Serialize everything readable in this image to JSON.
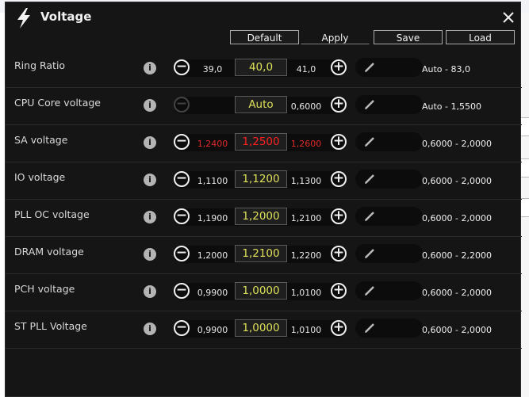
{
  "window": {
    "title": "Voltage",
    "title_icon": "lightning-icon",
    "close_icon": "close-icon"
  },
  "toolbar": {
    "default_label": "Default",
    "apply_label": "Apply",
    "save_label": "Save",
    "load_label": "Load"
  },
  "rows": [
    {
      "label": "Ring Ratio",
      "low": "39,0",
      "value": "40,0",
      "high": "41,0",
      "range": "Auto - 83,0",
      "red": false,
      "minus_enabled": true
    },
    {
      "label": "CPU Core voltage",
      "low": "",
      "value": "Auto",
      "high": "0,6000",
      "range": "Auto - 1,5500",
      "red": false,
      "minus_enabled": false
    },
    {
      "label": "SA voltage",
      "low": "1,2400",
      "value": "1,2500",
      "high": "1,2600",
      "range": "0,6000 - 2,0000",
      "red": true,
      "minus_enabled": true
    },
    {
      "label": "IO voltage",
      "low": "1,1100",
      "value": "1,1200",
      "high": "1,1300",
      "range": "0,6000 - 2,0000",
      "red": false,
      "minus_enabled": true
    },
    {
      "label": "PLL OC voltage",
      "low": "1,1900",
      "value": "1,2000",
      "high": "1,2100",
      "range": "0,6000 - 2,0000",
      "red": false,
      "minus_enabled": true
    },
    {
      "label": "DRAM voltage",
      "low": "1,2000",
      "value": "1,2100",
      "high": "1,2200",
      "range": "0,6000 - 2,2000",
      "red": false,
      "minus_enabled": true
    },
    {
      "label": "PCH voltage",
      "low": "0,9900",
      "value": "1,0000",
      "high": "1,0100",
      "range": "0,6000 - 2,0000",
      "red": false,
      "minus_enabled": true
    },
    {
      "label": "ST PLL Voltage",
      "low": "0,9900",
      "value": "1,0000",
      "high": "1,0100",
      "range": "0,6000 - 2,0000",
      "red": false,
      "minus_enabled": true
    }
  ],
  "icons": {
    "info": "info-icon",
    "minus": "minus-icon",
    "plus": "plus-icon",
    "edit": "pencil-icon"
  },
  "colors": {
    "window_bg": "#151515",
    "value_yellow": "#dde05a",
    "value_red": "#ff2020",
    "side_red": "#e02a2a",
    "text": "#d8d8d8"
  }
}
